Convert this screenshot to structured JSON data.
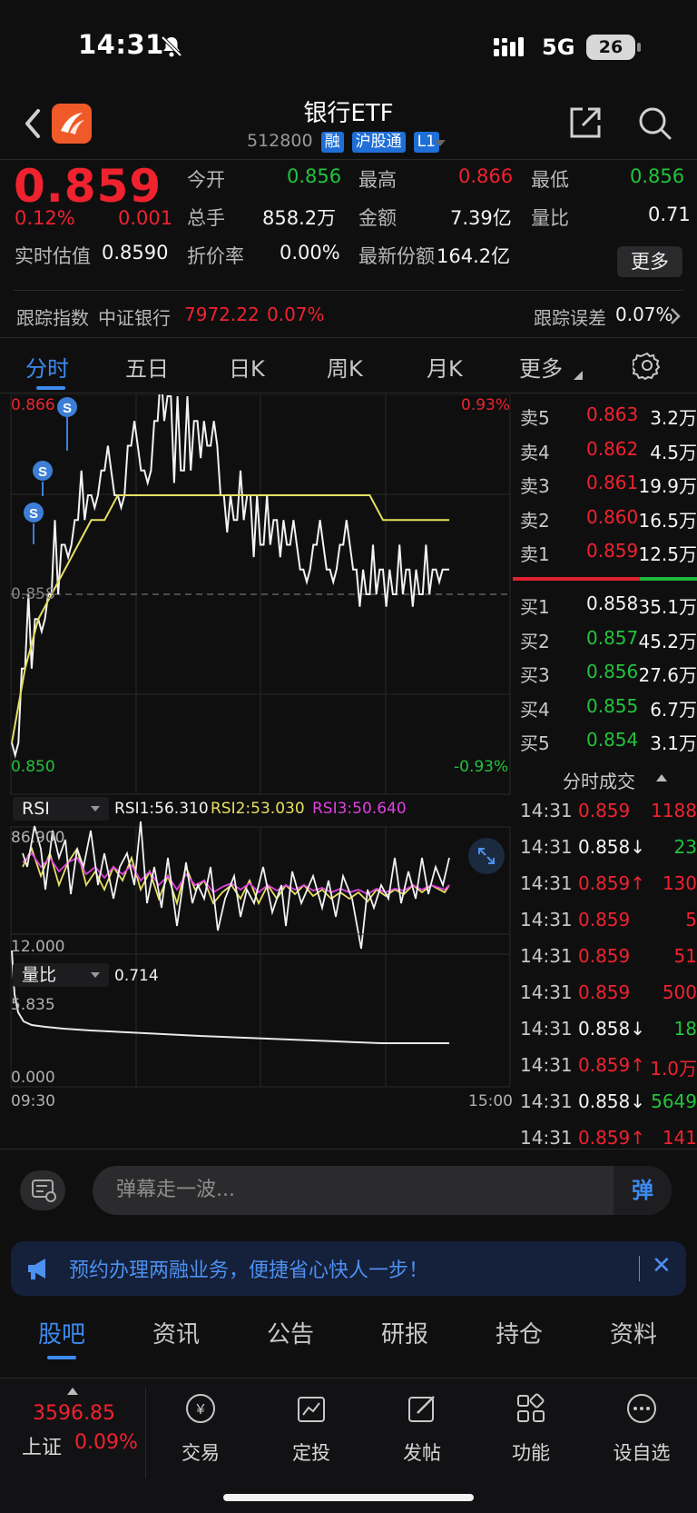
{
  "status": {
    "time": "14:31",
    "network": "5G",
    "battery": "26"
  },
  "header": {
    "title": "银行ETF",
    "code": "512800",
    "tags": [
      "融",
      "沪股通",
      "L1"
    ]
  },
  "quote": {
    "price": "0.859",
    "change_pct": "0.12%",
    "change": "0.001",
    "open_label": "今开",
    "open": "0.856",
    "high_label": "最高",
    "high": "0.866",
    "low_label": "最低",
    "low": "0.856",
    "vol_label": "总手",
    "vol": "858.2万",
    "amount_label": "金额",
    "amount": "7.39亿",
    "ratio_label": "量比",
    "ratio": "0.71",
    "iopv_label": "实时估值",
    "iopv": "0.8590",
    "discount_label": "折价率",
    "discount": "0.00%",
    "shares_label": "最新份额",
    "shares": "164.2亿",
    "more": "更多",
    "track_label": "跟踪指数",
    "track_index": "中证银行",
    "track_value": "7972.22",
    "track_pct": "0.07%",
    "err_label": "跟踪误差",
    "err_value": "0.07%"
  },
  "tabs": [
    "分时",
    "五日",
    "日K",
    "周K",
    "月K",
    "更多"
  ],
  "chart": {
    "price_high": "0.866",
    "pct_high": "0.93%",
    "price_mid": "0.858",
    "price_low": "0.850",
    "pct_low": "-0.93%",
    "marker": "S",
    "rsi_label": "RSI",
    "rsi1": "RSI1:56.310",
    "rsi2": "RSI2:53.030",
    "rsi3": "RSI3:50.640",
    "rsi_max": "86.900",
    "rsi_min": "12.000",
    "vr_label": "量比",
    "vr_value": "0.714",
    "vr_max": "5.835",
    "vr_min": "0.000",
    "t_start": "09:30",
    "t_end": "15:00"
  },
  "chart_data": {
    "type": "line",
    "x": [
      "09:30",
      "15:00"
    ],
    "ylim": [
      0.85,
      0.866
    ],
    "series": [
      {
        "name": "价格",
        "values": [
          0.852,
          0.855,
          0.857,
          0.858,
          0.86,
          0.861,
          0.862,
          0.863,
          0.862,
          0.864,
          0.863,
          0.865,
          0.866,
          0.863,
          0.865,
          0.864,
          0.862,
          0.861,
          0.862,
          0.86,
          0.861,
          0.86,
          0.859,
          0.86,
          0.859,
          0.86,
          0.859,
          0.858,
          0.859,
          0.858,
          0.859,
          0.858,
          0.859,
          0.859
        ]
      },
      {
        "name": "均价",
        "values": [
          0.852,
          0.855,
          0.857,
          0.858,
          0.859,
          0.86,
          0.861,
          0.861,
          0.862,
          0.862,
          0.862,
          0.862,
          0.862,
          0.862,
          0.862,
          0.862,
          0.862,
          0.862,
          0.862,
          0.862,
          0.862,
          0.862,
          0.862,
          0.862,
          0.862,
          0.862,
          0.862,
          0.862,
          0.861,
          0.861,
          0.861,
          0.861,
          0.861,
          0.861
        ]
      }
    ]
  },
  "order_book": {
    "asks": [
      {
        "label": "卖5",
        "price": "0.863",
        "vol": "3.2万"
      },
      {
        "label": "卖4",
        "price": "0.862",
        "vol": "4.5万"
      },
      {
        "label": "卖3",
        "price": "0.861",
        "vol": "19.9万"
      },
      {
        "label": "卖2",
        "price": "0.860",
        "vol": "16.5万"
      },
      {
        "label": "卖1",
        "price": "0.859",
        "vol": "12.5万"
      }
    ],
    "bids": [
      {
        "label": "买1",
        "price": "0.858",
        "vol": "35.1万"
      },
      {
        "label": "买2",
        "price": "0.857",
        "vol": "45.2万"
      },
      {
        "label": "买3",
        "price": "0.856",
        "vol": "27.6万"
      },
      {
        "label": "买4",
        "price": "0.855",
        "vol": "6.7万"
      },
      {
        "label": "买5",
        "price": "0.854",
        "vol": "3.1万"
      }
    ]
  },
  "ticks_title": "分时成交",
  "ticks": [
    {
      "time": "14:31",
      "price": "0.859",
      "dir": "",
      "vol": "1188",
      "pc": "red",
      "vc": "red"
    },
    {
      "time": "14:31",
      "price": "0.858↓",
      "dir": "",
      "vol": "23",
      "pc": "white",
      "vc": "green"
    },
    {
      "time": "14:31",
      "price": "0.859↑",
      "dir": "",
      "vol": "130",
      "pc": "red",
      "vc": "red"
    },
    {
      "time": "14:31",
      "price": "0.859",
      "dir": "",
      "vol": "5",
      "pc": "red",
      "vc": "red"
    },
    {
      "time": "14:31",
      "price": "0.859",
      "dir": "",
      "vol": "51",
      "pc": "red",
      "vc": "red"
    },
    {
      "time": "14:31",
      "price": "0.859",
      "dir": "",
      "vol": "500",
      "pc": "red",
      "vc": "red"
    },
    {
      "time": "14:31",
      "price": "0.858↓",
      "dir": "",
      "vol": "18",
      "pc": "white",
      "vc": "green"
    },
    {
      "time": "14:31",
      "price": "0.859↑",
      "dir": "",
      "vol": "1.0万",
      "pc": "red",
      "vc": "red"
    },
    {
      "time": "14:31",
      "price": "0.858↓",
      "dir": "",
      "vol": "5649",
      "pc": "white",
      "vc": "green"
    },
    {
      "time": "14:31",
      "price": "0.859↑",
      "dir": "",
      "vol": "141",
      "pc": "red",
      "vc": "red"
    }
  ],
  "comment": {
    "placeholder": "弹幕走一波...",
    "send": "弹"
  },
  "banner": {
    "text": "预约办理两融业务，便捷省心快人一步！"
  },
  "subtabs": [
    "股吧",
    "资讯",
    "公告",
    "研报",
    "持仓",
    "资料"
  ],
  "bottom": {
    "index_value": "3596.85",
    "index_name": "上证",
    "index_pct": "0.09%",
    "items": [
      "交易",
      "定投",
      "发帖",
      "功能",
      "设自选"
    ]
  }
}
